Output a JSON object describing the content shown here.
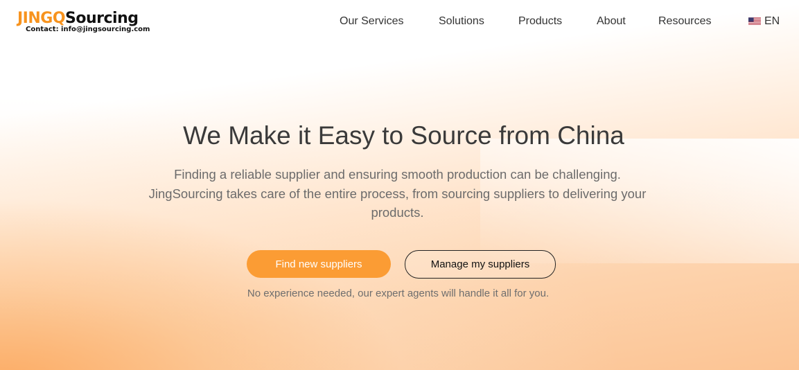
{
  "logo": {
    "brand_part1": "JING",
    "brand_q": "Q",
    "brand_part2": "Sourcing",
    "contact": "Contact: info@jingsourcing.com"
  },
  "nav": {
    "items": [
      {
        "label": "Our Services"
      },
      {
        "label": "Solutions"
      },
      {
        "label": "Products"
      },
      {
        "label": "About"
      },
      {
        "label": "Resources"
      }
    ],
    "language": {
      "label": "EN",
      "flag_icon": "us-flag-icon"
    }
  },
  "hero": {
    "title": "We Make it Easy to Source from China",
    "subtitle": "Finding a reliable supplier and ensuring smooth production can be challenging. JingSourcing takes care of the entire process, from sourcing suppliers to delivering your products.",
    "primary_button": "Find new suppliers",
    "secondary_button": "Manage my suppliers",
    "note": "No experience needed, our expert agents will handle it all for you."
  },
  "colors": {
    "accent": "#fb9c34",
    "brand_orange": "#f7931e",
    "text_dark": "#333333",
    "text_muted": "#6b6b6b"
  }
}
